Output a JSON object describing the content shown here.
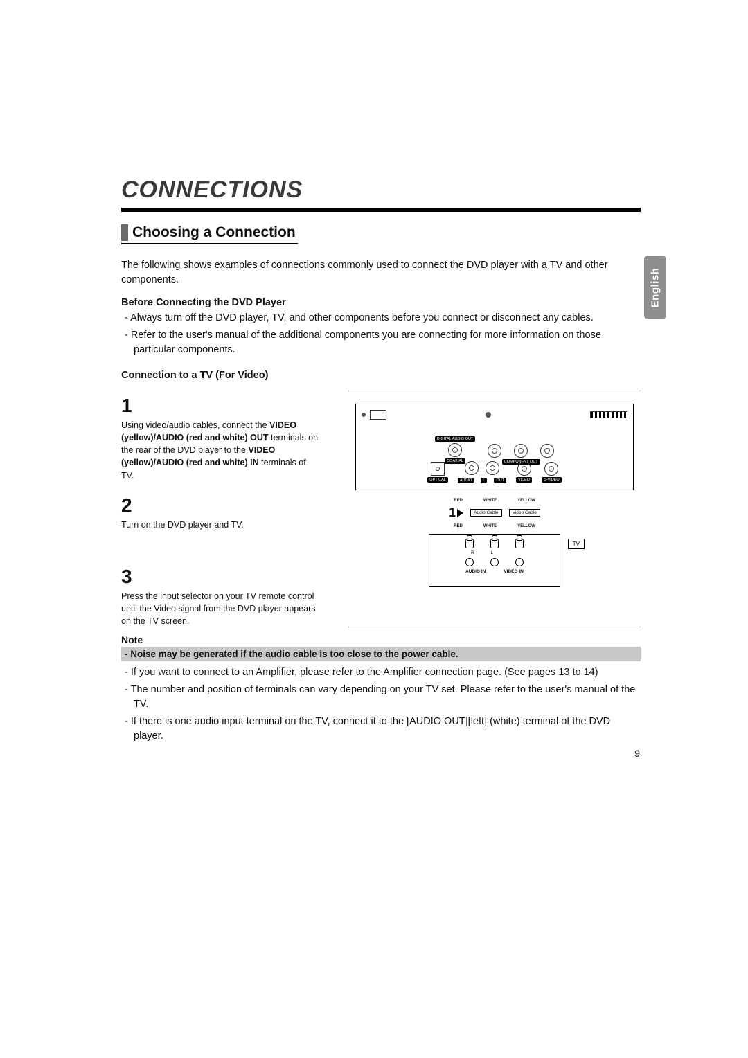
{
  "sideTab": "English",
  "pageNumber": "9",
  "chapter": {
    "title": "CONNECTIONS"
  },
  "section": {
    "heading": "Choosing a Connection",
    "intro": "The following shows examples of connections commonly used to connect the DVD player with a TV and other components.",
    "before": {
      "heading": "Before Connecting the DVD Player",
      "items": [
        "Always turn off the DVD player, TV, and other components before you connect or disconnect any cables.",
        "Refer to the user's manual of the additional components you are connecting for more information on those particular components."
      ]
    },
    "connTv": {
      "heading": "Connection to a TV (For Video)"
    }
  },
  "steps": {
    "s1": {
      "num": "1",
      "pre": "Using video/audio cables, connect the ",
      "b1": "VIDEO (yellow)/AUDIO (red and white) OUT",
      "mid": " terminals on the rear of the DVD player to the ",
      "b2": "VIDEO (yellow)/AUDIO (red and white) IN",
      "post": " terminals of TV."
    },
    "s2": {
      "num": "2",
      "text": "Turn on the DVD player and TV."
    },
    "s3": {
      "num": "3",
      "text": "Press the input selector on your TV remote control until the Video signal from the DVD player appears on the TV screen."
    }
  },
  "note": {
    "label": "Note",
    "bold": "Noise may be generated if the audio cable is too close to the power cable.",
    "items": [
      "If you want to connect to an Amplifier, please refer to the Amplifier connection page. (See pages 13 to 14)",
      "The number and position of terminals can vary depending on your TV set. Please refer to the user's manual of the TV.",
      "If there is one audio input terminal on the TV, connect it to the [AUDIO OUT][left] (white) terminal of the DVD player."
    ]
  },
  "diagram": {
    "digitalAudioOut": "DIGITAL AUDIO OUT",
    "coaxial": "COAXIAL",
    "componentOut": "COMPONENT OUT",
    "optical": "OPTICAL",
    "audio": "AUDIO",
    "l": "L",
    "out": "OUT",
    "video": "VIDEO",
    "svideo": "S-VIDEO",
    "red": "RED",
    "white": "WHITE",
    "yellow": "YELLOW",
    "audioCable": "Audio Cable",
    "videoCable": "Video Cable",
    "arrow": "1",
    "r": "R",
    "tv": "TV",
    "audioIn": "AUDIO IN",
    "videoIn": "VIDEO IN"
  }
}
